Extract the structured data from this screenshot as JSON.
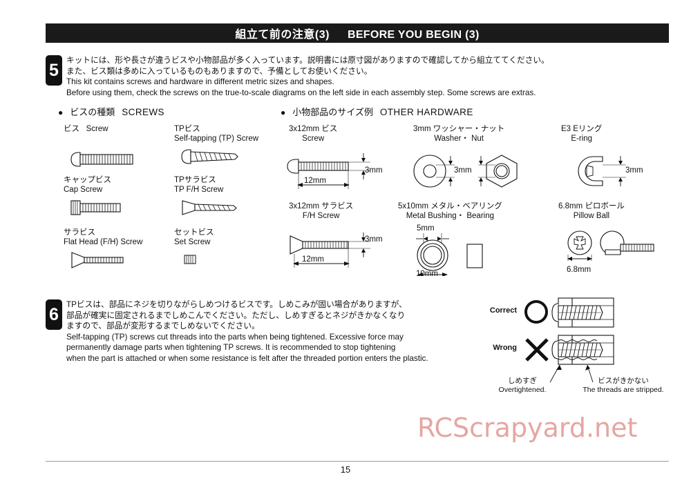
{
  "banner": {
    "title_jp": "組立て前の注意(3)",
    "title_en": "BEFORE YOU BEGIN (3)"
  },
  "steps": [
    {
      "number": "5",
      "lines": [
        "キットには、形や長さが違うビスや小物部品が多く入っています。説明書には原寸図がありますので確認してから組立ててください。",
        "また、ビス類は多めに入っているものもありますので、予備としてお使いください。",
        "This kit contains screws and hardware in different metric sizes and shapes.",
        "Before using them, check the screws on the true-to-scale diagrams on the left side in each assembly step.  Some screws are extras."
      ]
    },
    {
      "number": "6",
      "lines": [
        "TPビスは、部品にネジを切りながらしめつけるビスです。しめこみが固い場合がありますが、",
        "部品が確実に固定されるまでしめこんでください。ただし、しめすぎるとネジがきかなくなり",
        "ますので、部品が変形するまでしめないでください。",
        "Self-tapping (TP) screws cut threads into the parts when being tightened.  Excessive force may",
        "permanently damage parts when tightening TP screws.  It is recommended to stop tightening",
        "when the part is attached or when some resistance is felt after the threaded portion enters the plastic."
      ]
    }
  ],
  "sections": {
    "screws": {
      "bullet": "●",
      "jp": "ビスの種類",
      "en": "SCREWS"
    },
    "hardware": {
      "bullet": "●",
      "jp": "小物部品のサイズ例",
      "en": "OTHER HARDWARE"
    }
  },
  "screw_items": [
    {
      "jp": "ビス",
      "en": "Screw",
      "inline": true
    },
    {
      "jp": "TPビス",
      "en": "Self-tapping (TP) Screw",
      "inline": false
    },
    {
      "jp": "キャップビス",
      "en": "Cap Screw",
      "inline": false
    },
    {
      "jp": "TPサラビス",
      "en": "TP F/H Screw",
      "inline": false
    },
    {
      "jp": "サラビス",
      "en": "Flat Head (F/H) Screw",
      "inline": false
    },
    {
      "jp": "セットビス",
      "en": "Set Screw",
      "inline": false
    }
  ],
  "hardware_items": [
    {
      "jp": "3x12mm ビス",
      "en": "Screw",
      "dims": {
        "length": "12mm",
        "thickness": "3mm"
      }
    },
    {
      "jp": "3mm ワッシャー・ナット",
      "en": "Washer・ Nut",
      "dims": {
        "bore": "3mm"
      }
    },
    {
      "jp": "E3 Eリング",
      "en": "E-ring",
      "dims": {
        "bore": "3mm"
      }
    },
    {
      "jp": "3x12mm サラビス",
      "en": "F/H Screw",
      "dims": {
        "length": "12mm",
        "thickness": "3mm"
      }
    },
    {
      "jp": "5x10mm メタル・ベアリング",
      "en": "Metal Bushing・ Bearing",
      "dims": {
        "bore": "5mm",
        "outer": "10mm"
      }
    },
    {
      "jp": "6.8mm ピロボール",
      "en": "Pillow Ball",
      "dims": {
        "diameter": "6.8mm"
      }
    }
  ],
  "correct_wrong": {
    "correct_label": "Correct",
    "wrong_label": "Wrong",
    "note_left_jp": "しめすぎ",
    "note_left_en": "Overtightened.",
    "note_right_jp": "ビスがきかない",
    "note_right_en": "The threads are stripped."
  },
  "watermark": "RCScrapyard.net",
  "footer": {
    "page_number": "15"
  },
  "colors": {
    "banner_bg": "#1a1a1a",
    "ink": "#111111",
    "watermark": "#e5a6a2",
    "rule": "#9a9a9a"
  }
}
